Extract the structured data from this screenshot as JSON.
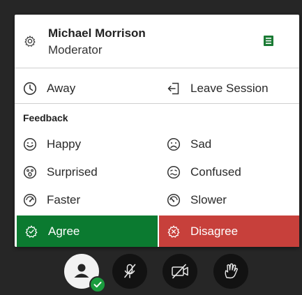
{
  "user": {
    "name": "Michael Morrison",
    "role": "Moderator"
  },
  "actions": {
    "away_label": "Away",
    "leave_label": "Leave Session"
  },
  "feedback": {
    "section_label": "Feedback",
    "items": [
      {
        "label": "Happy",
        "icon": "happy-face-icon"
      },
      {
        "label": "Sad",
        "icon": "sad-face-icon"
      },
      {
        "label": "Surprised",
        "icon": "surprised-face-icon"
      },
      {
        "label": "Confused",
        "icon": "confused-face-icon"
      },
      {
        "label": "Faster",
        "icon": "speedometer-fast-icon"
      },
      {
        "label": "Slower",
        "icon": "speedometer-slow-icon"
      }
    ]
  },
  "votes": {
    "agree_label": "Agree",
    "disagree_label": "Disagree"
  },
  "colors": {
    "background": "#262626",
    "agree": "#0b7a30",
    "disagree": "#c7403b",
    "list_icon": "#1a7a34",
    "status_badge": "#1a9c3e"
  },
  "toolbar": {
    "buttons": [
      "user-status-icon",
      "microphone-muted-icon",
      "camera-off-icon",
      "raise-hand-icon"
    ]
  }
}
